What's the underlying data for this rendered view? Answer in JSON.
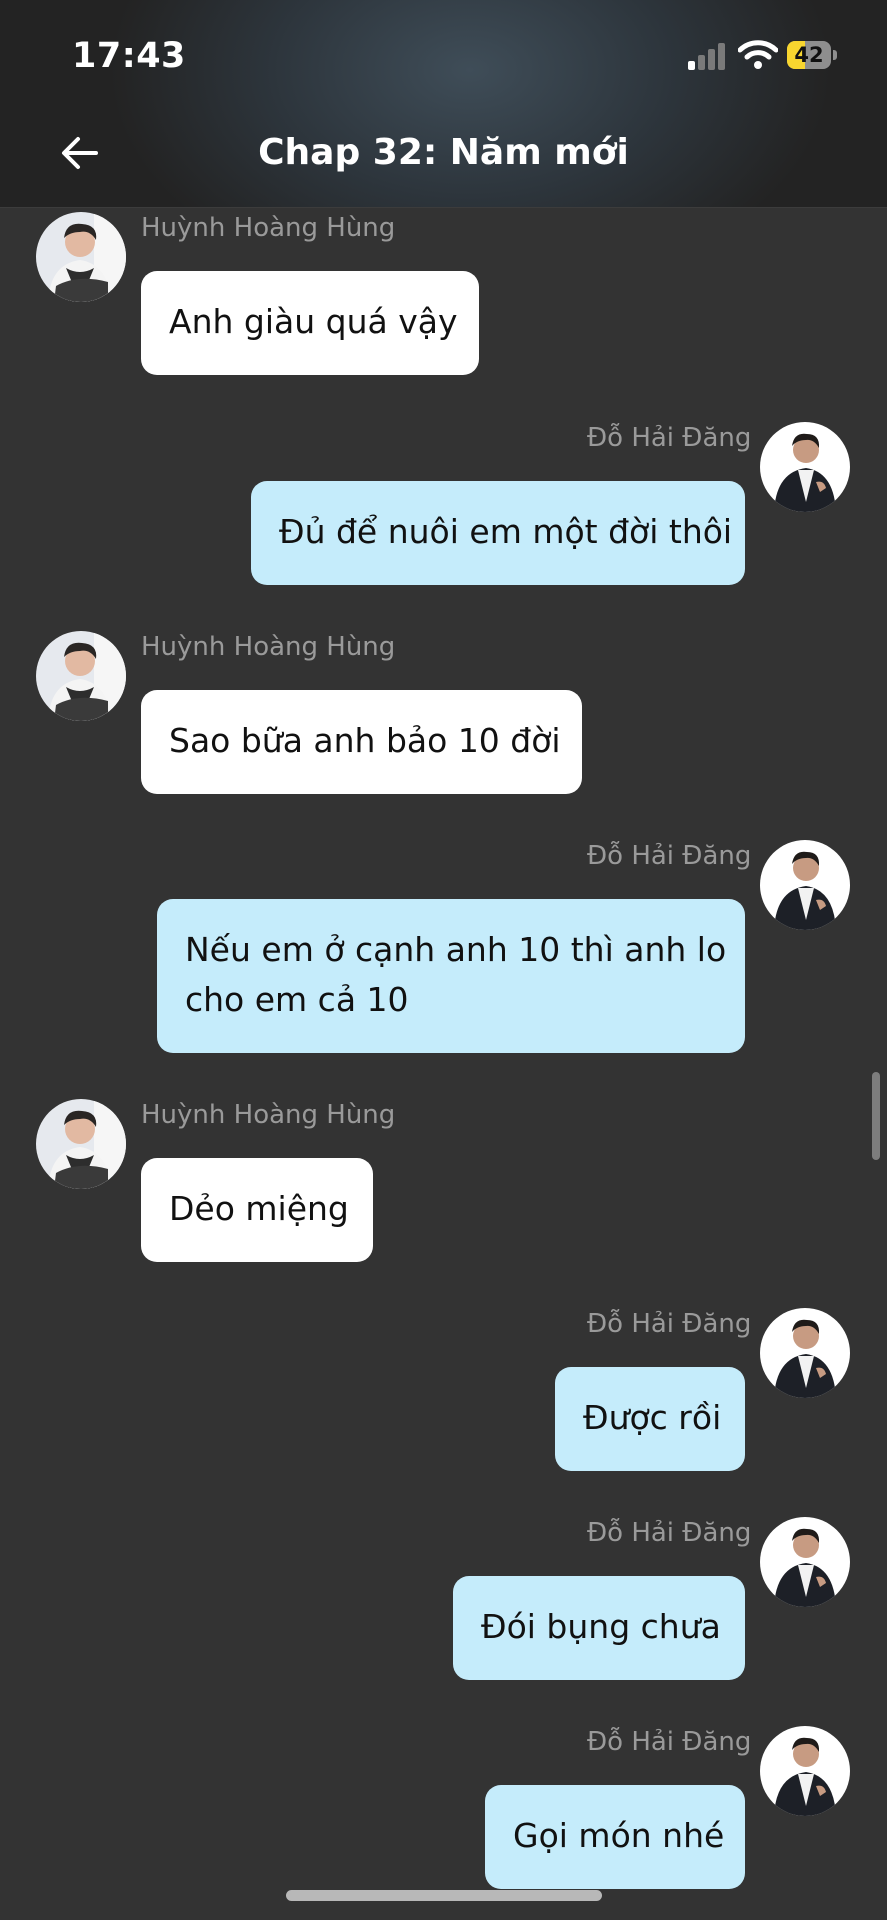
{
  "status_bar": {
    "time": "17:43",
    "battery_level": "42",
    "signal_bars_active": 1,
    "signal_bars_total": 4
  },
  "header": {
    "title": "Chap 32: Năm mới"
  },
  "colors": {
    "background": "#333333",
    "left_bubble": "#ffffff",
    "right_bubble": "#c5ecfb",
    "sender_name": "#9a9a9a",
    "battery": "#f8d62f"
  },
  "messages": [
    {
      "side": "left",
      "sender": "Huỳnh Hoàng Hùng",
      "lines": [
        "Anh giàu quá vậy"
      ]
    },
    {
      "side": "right",
      "sender": "Đỗ Hải Đăng",
      "lines": [
        "Đủ để nuôi em một đời thôi"
      ]
    },
    {
      "side": "left",
      "sender": "Huỳnh Hoàng Hùng",
      "lines": [
        "Sao bữa anh bảo 10 đời"
      ]
    },
    {
      "side": "right",
      "sender": "Đỗ Hải Đăng",
      "lines": [
        "Nếu em ở cạnh anh 10 thì anh lo",
        "cho em cả 10"
      ]
    },
    {
      "side": "left",
      "sender": "Huỳnh Hoàng Hùng",
      "lines": [
        "Dẻo miệng"
      ]
    },
    {
      "side": "right",
      "sender": "Đỗ Hải Đăng",
      "lines": [
        "Được rồi"
      ]
    },
    {
      "side": "right",
      "sender": "Đỗ Hải Đăng",
      "lines": [
        "Đói bụng chưa"
      ]
    },
    {
      "side": "right",
      "sender": "Đỗ Hải Đăng",
      "lines": [
        "Gọi món nhé"
      ]
    }
  ]
}
